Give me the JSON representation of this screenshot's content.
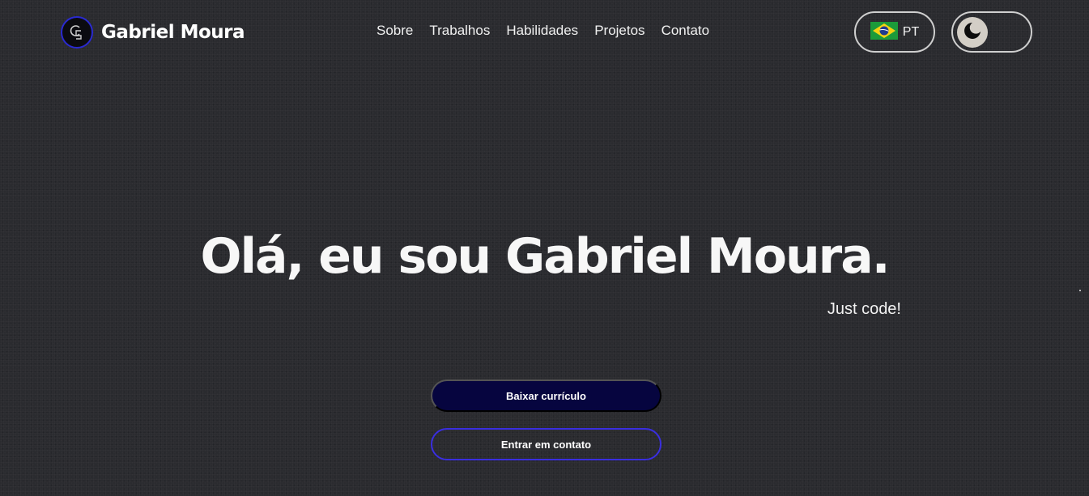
{
  "header": {
    "logo_name": "Gabriel Moura",
    "nav": [
      {
        "label": "Sobre"
      },
      {
        "label": "Trabalhos"
      },
      {
        "label": "Habilidades"
      },
      {
        "label": "Projetos"
      },
      {
        "label": "Contato"
      }
    ],
    "language": {
      "code": "PT",
      "flag_icon": "brazil-flag-icon"
    },
    "theme_toggle": {
      "icon": "moon-icon",
      "mode": "dark"
    }
  },
  "hero": {
    "title": "Olá, eu sou Gabriel Moura.",
    "subtitle": "Just code!",
    "primary_button": "Baixar currículo",
    "secondary_button": "Entrar em contato"
  },
  "colors": {
    "background": "#2a2b2f",
    "primary_button": "#06053f",
    "accent_border": "#3a2ee0",
    "text": "#ffffff"
  }
}
